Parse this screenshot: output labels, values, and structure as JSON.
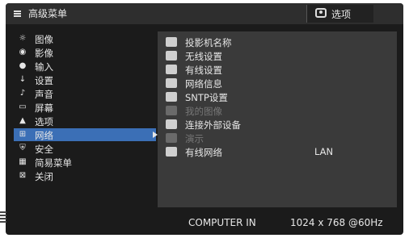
{
  "header": {
    "title": "高级菜单",
    "options_label": "选项"
  },
  "left_menu": [
    {
      "label": "图像",
      "icon": "picture-icon"
    },
    {
      "label": "影像",
      "icon": "video-icon"
    },
    {
      "label": "输入",
      "icon": "input-icon"
    },
    {
      "label": "设置",
      "icon": "setup-icon"
    },
    {
      "label": "声音",
      "icon": "audio-icon"
    },
    {
      "label": "屏幕",
      "icon": "screen-icon"
    },
    {
      "label": "选项",
      "icon": "options-icon"
    },
    {
      "label": "网络",
      "icon": "network-icon"
    },
    {
      "label": "安全",
      "icon": "security-icon"
    },
    {
      "label": "简易菜单",
      "icon": "easy-menu-icon"
    },
    {
      "label": "关闭",
      "icon": "close-icon"
    }
  ],
  "sub_menu": [
    {
      "label": "投影机名称",
      "icon": "projector-name-icon"
    },
    {
      "label": "无线设置",
      "icon": "wireless-setup-icon"
    },
    {
      "label": "有线设置",
      "icon": "wired-setup-icon"
    },
    {
      "label": "网络信息",
      "icon": "network-info-icon"
    },
    {
      "label": "SNTP设置",
      "icon": "sntp-icon"
    },
    {
      "label": "我的图像",
      "icon": "my-image-icon"
    },
    {
      "label": "连接外部设备",
      "icon": "external-device-icon"
    },
    {
      "label": "演示",
      "icon": "presentation-icon"
    },
    {
      "label": "有线网络",
      "icon": "wired-network-icon",
      "value": "LAN"
    }
  ],
  "status": {
    "input": "COMPUTER IN",
    "signal": "1024 x 768 @60Hz"
  }
}
